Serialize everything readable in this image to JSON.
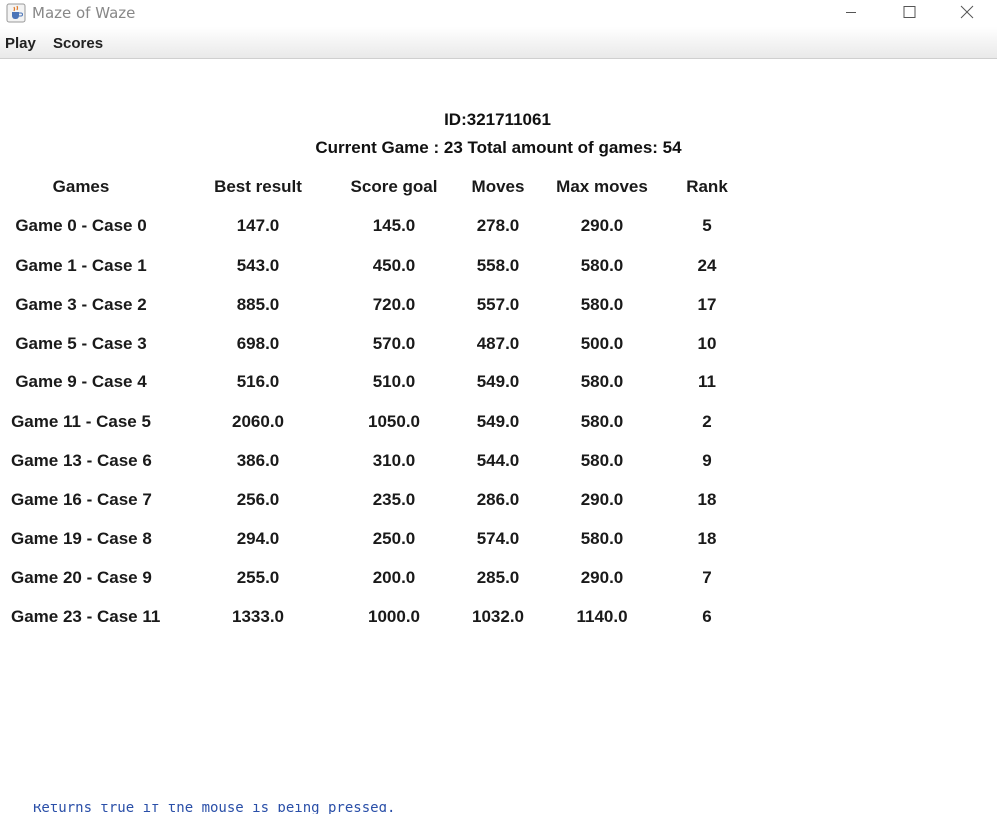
{
  "window": {
    "title": "Maze of Waze",
    "icon": "java-cup-icon",
    "controls": [
      "minimize-icon",
      "maximize-icon",
      "close-icon"
    ]
  },
  "menu": {
    "play": "Play",
    "scores": "Scores"
  },
  "scores": {
    "id_line": "ID:321711061",
    "summary": "Current Game : 23 Total amount of games: 54",
    "headers": [
      "Games",
      "Best result",
      "Score goal",
      "Moves",
      "Max moves",
      "Rank"
    ],
    "rows": [
      [
        "Game 0 - Case 0",
        "147.0",
        "145.0",
        "278.0",
        "290.0",
        "5"
      ],
      [
        "Game 1 - Case 1",
        "543.0",
        "450.0",
        "558.0",
        "580.0",
        "24"
      ],
      [
        "Game 3 - Case 2",
        "885.0",
        "720.0",
        "557.0",
        "580.0",
        "17"
      ],
      [
        "Game 5 - Case 3",
        "698.0",
        "570.0",
        "487.0",
        "500.0",
        "10"
      ],
      [
        "Game 9 - Case 4",
        "516.0",
        "510.0",
        "549.0",
        "580.0",
        "11"
      ],
      [
        "Game 11 - Case 5",
        "2060.0",
        "1050.0",
        "549.0",
        "580.0",
        "2"
      ],
      [
        "Game 13 - Case 6",
        "386.0",
        "310.0",
        "544.0",
        "580.0",
        "9"
      ],
      [
        "Game 16 - Case 7",
        "256.0",
        "235.0",
        "286.0",
        "290.0",
        "18"
      ],
      [
        "Game 19 - Case 8",
        "294.0",
        "250.0",
        "574.0",
        "580.0",
        "18"
      ],
      [
        "Game 20 - Case 9",
        "255.0",
        "200.0",
        "285.0",
        "290.0",
        "7"
      ],
      [
        "Game 23 - Case 11",
        "1333.0",
        "1000.0",
        "1032.0",
        "1140.0",
        "6"
      ]
    ]
  },
  "background_text": "Returns true if the mouse is being pressed."
}
